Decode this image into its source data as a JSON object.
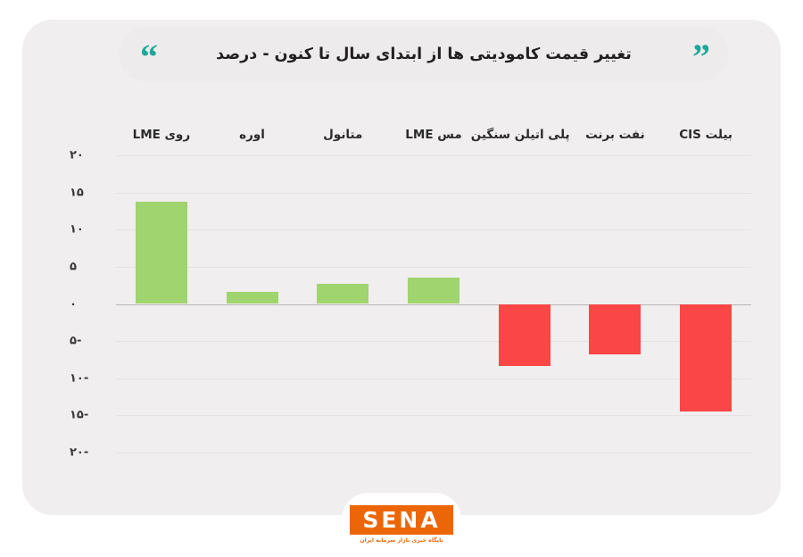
{
  "header": {
    "title": "تغییر قیمت کامودیتی ها از ابتدای سال تا کنون - درصد",
    "quote_open": "“",
    "quote_close": "”",
    "accent_color": "#1fa79a"
  },
  "footer": {
    "logo_text": "SENA",
    "logo_subtitle": "پایگاه خبری بازار سرمایه ایران",
    "logo_color": "#ec6608"
  },
  "colors": {
    "positive": "#a0d46e",
    "negative": "#fa4646",
    "card_background": "#f0eeee",
    "gridline": "#e4e2e2",
    "zero_axis": "#b9b7b7"
  },
  "chart_data": {
    "type": "bar",
    "title": "تغییر قیمت کامودیتی ها از ابتدای سال تا کنون - درصد",
    "subtitle": "",
    "xlabel": "",
    "ylabel": "",
    "ylim": [
      -20,
      20
    ],
    "grid": true,
    "legend": "none",
    "orientation": "rtl",
    "value_unit": "درصد",
    "ytick_values": [
      20,
      15,
      10,
      5,
      0,
      -5,
      -10,
      -15,
      -20
    ],
    "ytick_labels": [
      "۲۰",
      "۱۵",
      "۱۰",
      "۵",
      "۰",
      "-۵",
      "-۱۰",
      "-۱۵",
      "-۲۰"
    ],
    "categories": [
      "بیلت CIS",
      "نفت برنت",
      "پلی اتیلن سنگین",
      "مس LME",
      "متانول",
      "اوره",
      "روی LME"
    ],
    "values": [
      -14.5,
      -6.8,
      -8.3,
      3.5,
      2.7,
      1.6,
      13.7
    ],
    "bar_colors": [
      "#fa4646",
      "#fa4646",
      "#fa4646",
      "#a0d46e",
      "#a0d46e",
      "#a0d46e",
      "#a0d46e"
    ]
  }
}
